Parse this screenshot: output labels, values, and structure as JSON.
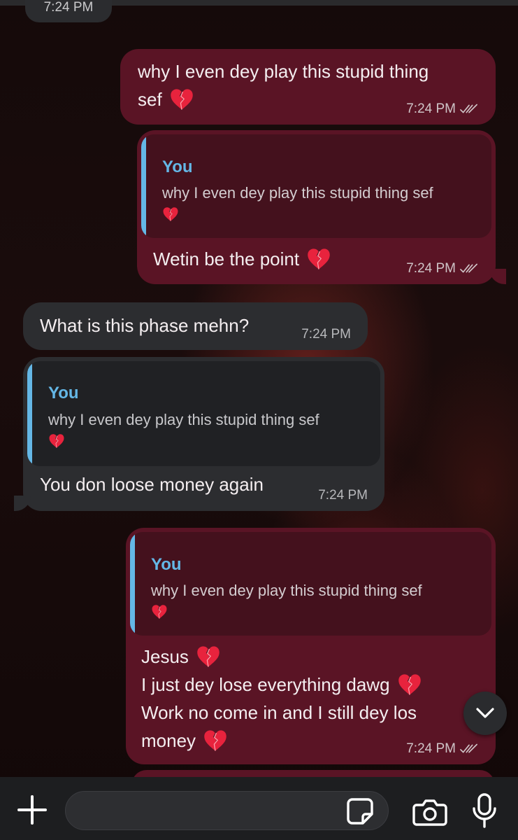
{
  "top_timestamp": "7:24 PM",
  "messages": [
    {
      "direction": "outgoing",
      "lines": [
        "why I even dey play this stupid thing",
        "sef"
      ],
      "emoji": "broken-heart",
      "time": "7:24 PM",
      "status": "read"
    },
    {
      "direction": "outgoing",
      "reply": {
        "name": "You",
        "text": "why I even dey play this stupid thing sef"
      },
      "text": "Wetin be the point",
      "emoji": "broken-heart",
      "time": "7:24 PM",
      "status": "read"
    },
    {
      "direction": "incoming",
      "text": "What is this phase mehn?",
      "time": "7:24 PM"
    },
    {
      "direction": "incoming",
      "reply": {
        "name": "You",
        "text": "why I even dey play this stupid thing sef"
      },
      "text": "You don loose money again",
      "time": "7:24 PM"
    },
    {
      "direction": "outgoing",
      "reply": {
        "name": "You",
        "text": "why I even dey play this stupid thing sef"
      },
      "lines": [
        "Jesus",
        "I just dey lose everything dawg",
        "Work no come in and I still dey los",
        "money"
      ],
      "time": "7:24 PM",
      "status": "read"
    }
  ],
  "composer": {
    "placeholder": "",
    "icons": [
      "plus-icon",
      "sticker-icon",
      "camera-icon",
      "microphone-icon"
    ]
  },
  "scroll_button_icon": "chevron-down-icon",
  "colors": {
    "outgoing_bubble": "#5a1425",
    "incoming_bubble": "#2c2d30",
    "reply_accent": "#64b7e6",
    "background": "#0f0708"
  }
}
